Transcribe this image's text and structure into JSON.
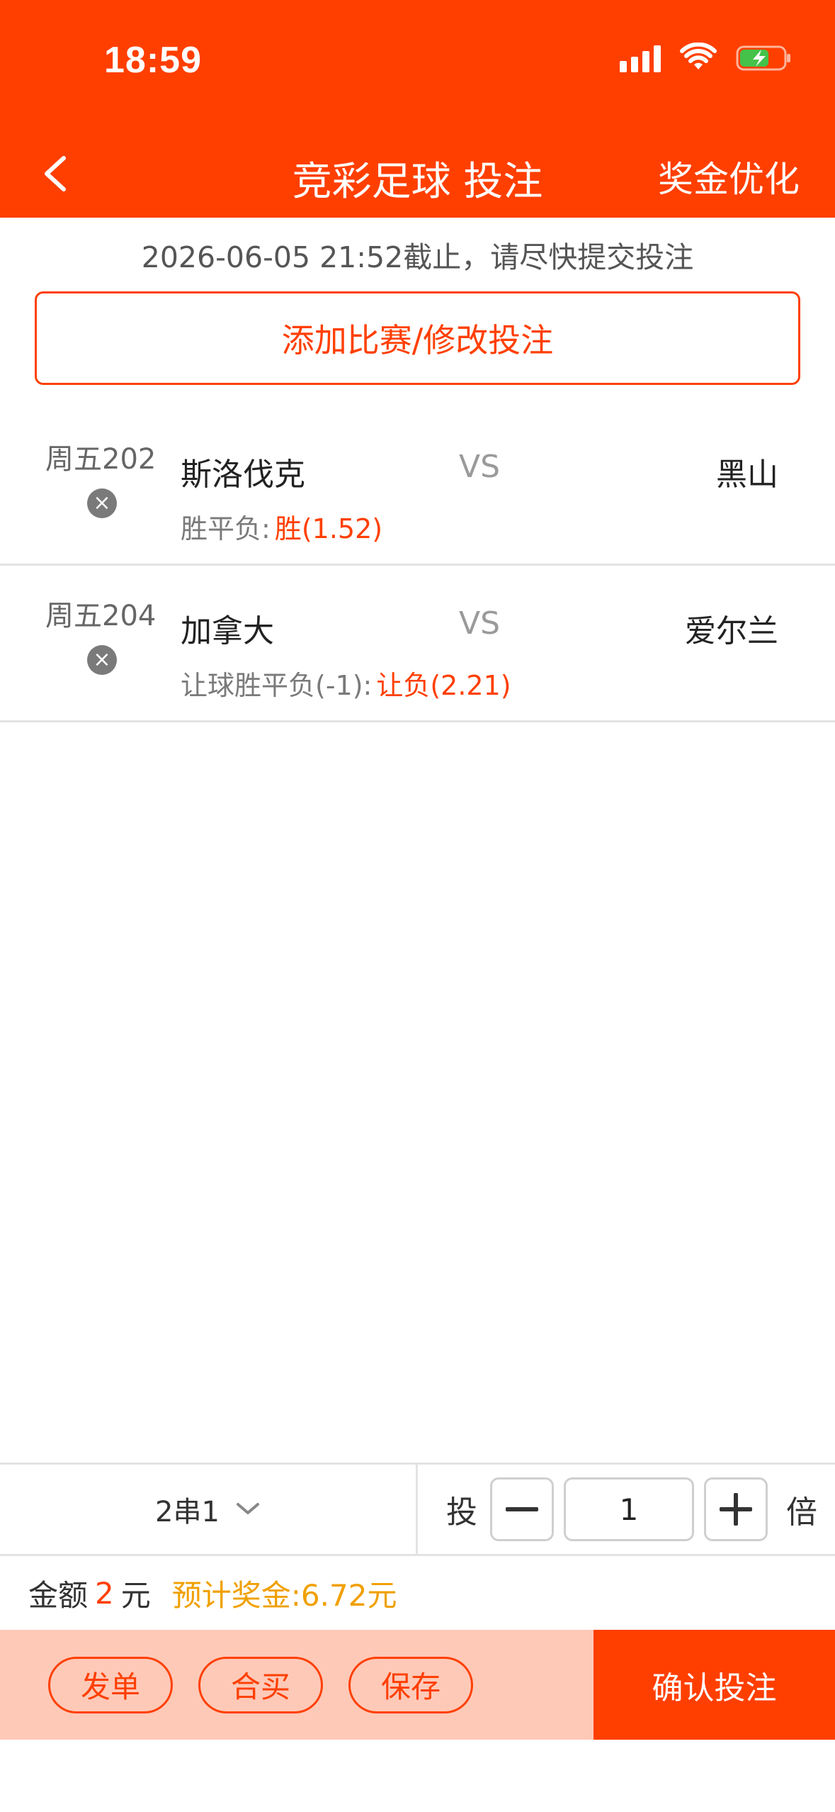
{
  "status": {
    "time": "18:59"
  },
  "header": {
    "title": "竞彩足球 投注",
    "right": "奖金优化"
  },
  "deadline": "2026-06-05 21:52截止，请尽快提交投注",
  "add_button": "添加比赛/修改投注",
  "matches": [
    {
      "num": "周五202",
      "home": "斯洛伐克",
      "vs": "VS",
      "away": "黑山",
      "bet_type": "胜平负:",
      "pick": "胜(1.52)"
    },
    {
      "num": "周五204",
      "home": "加拿大",
      "vs": "VS",
      "away": "爱尔兰",
      "bet_type": "让球胜平负(-1):",
      "pick": "让负(2.21)"
    }
  ],
  "controls": {
    "combo": "2串1",
    "tou": "投",
    "multiplier": "1",
    "bei": "倍"
  },
  "amount": {
    "label": "金额",
    "value": "2",
    "unit": "元",
    "prize_label": "预计奖金:",
    "prize": "6.72元"
  },
  "bottom": {
    "share": "发单",
    "group": "合买",
    "save": "保存",
    "confirm": "确认投注"
  },
  "colors": {
    "brand": "#ff3f00",
    "bottom_bar": "#ffc9b8"
  }
}
